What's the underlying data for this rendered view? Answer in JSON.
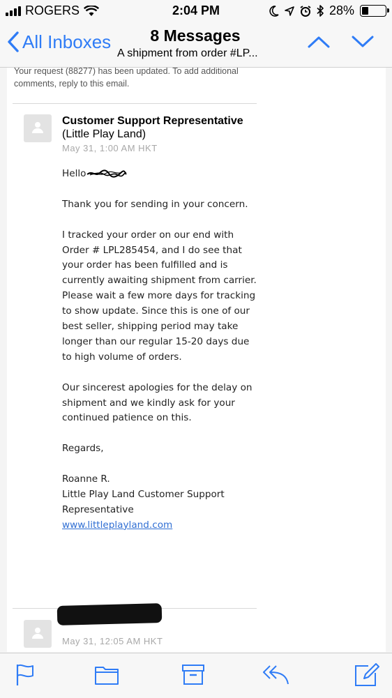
{
  "status_bar": {
    "carrier": "ROGERS",
    "time": "2:04 PM",
    "battery": "28%",
    "battery_level": 0.28,
    "icons": [
      "signal-icon",
      "wifi-icon",
      "moon-icon",
      "location-icon",
      "alarm-icon",
      "bluetooth-icon",
      "battery-icon"
    ]
  },
  "nav": {
    "back_label": "All Inboxes",
    "title": "8 Messages",
    "subtitle": "A shipment from order #LP..."
  },
  "previous_message": {
    "text": "Your request (88277) has been updated. To add additional comments, reply to this email."
  },
  "message": {
    "sender_name": "Customer Support Representative",
    "sender_org": "(Little Play Land)",
    "date": "May 31, 1:00 AM HKT",
    "greeting": "Hello",
    "paragraphs": [
      "Thank you for sending in your concern.",
      "I tracked your order on our end with Order # LPL285454, and I do see that your order has been fulfilled and is currently awaiting shipment from carrier. Please wait a few more days for tracking to show update. Since this is one of our best seller, shipping period may take longer than our regular 15-20 days due to high volume of orders.",
      "Our sincerest apologies for the delay on shipment and we kindly ask for your continued patience on this.",
      "Regards,"
    ],
    "signature_name": "Roanne R.",
    "signature_title": "Little Play Land Customer Support Representative",
    "link": "www.littleplayland.com"
  },
  "next_message": {
    "date": "May 31, 12:05 AM HKT"
  },
  "toolbar": {
    "icons": [
      "flag-icon",
      "folder-icon",
      "archive-icon",
      "reply-icon",
      "compose-icon"
    ]
  },
  "colors": {
    "accent": "#2f7cf6",
    "link": "#2f6ed3",
    "muted": "#a8a8a8"
  }
}
